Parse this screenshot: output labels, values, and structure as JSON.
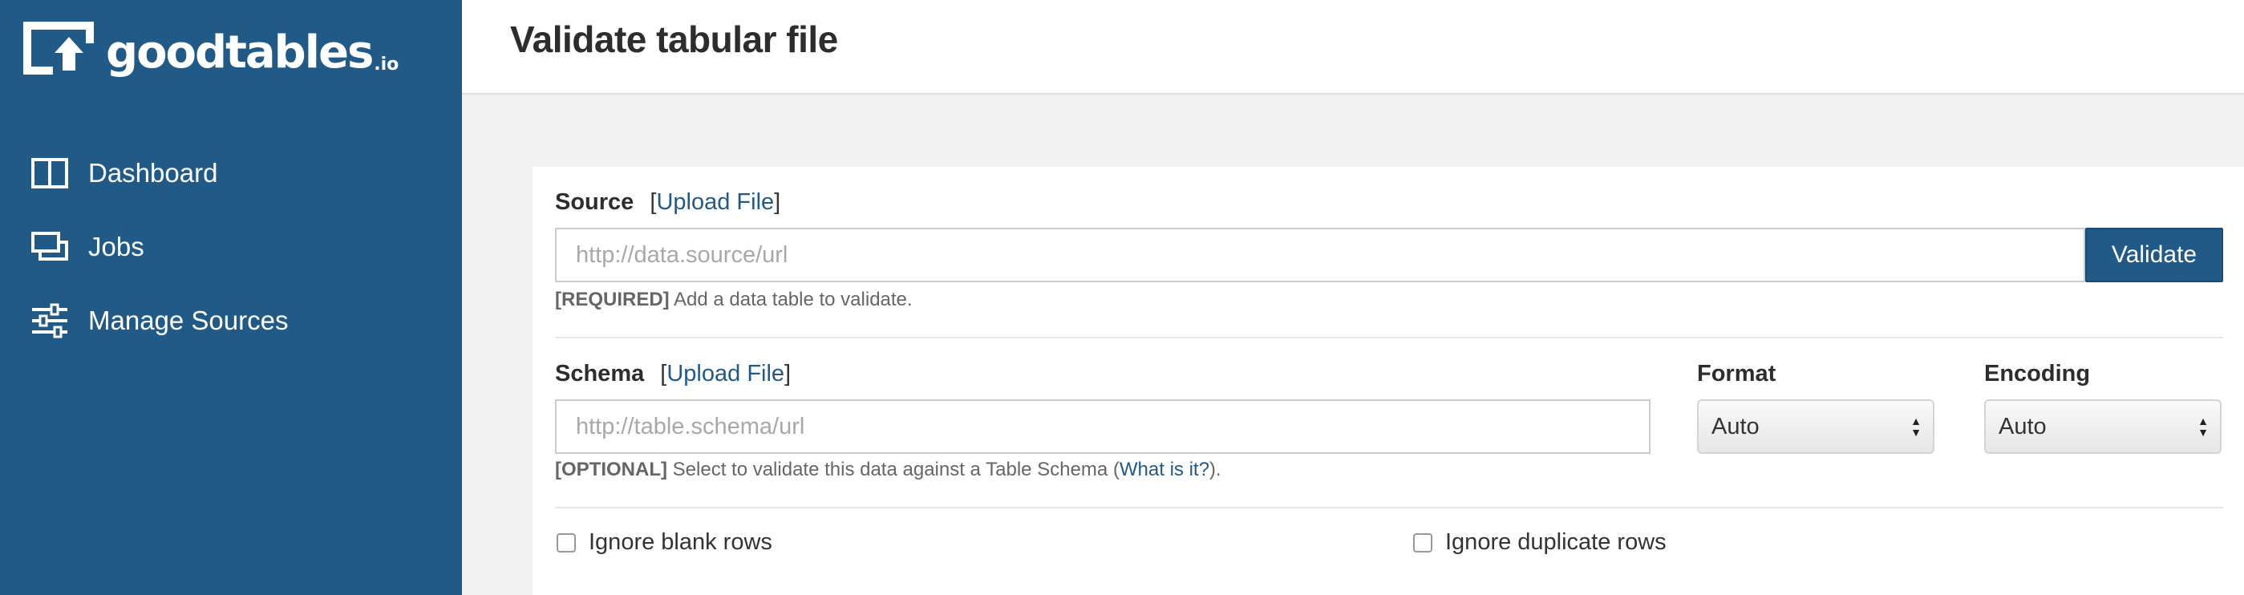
{
  "brand": {
    "name": "goodtables",
    "tld": ".io",
    "color": "#225a87"
  },
  "sidebar": {
    "items": [
      {
        "label": "Dashboard",
        "icon": "columns-icon"
      },
      {
        "label": "Jobs",
        "icon": "jobs-icon"
      },
      {
        "label": "Manage Sources",
        "icon": "sliders-icon"
      }
    ]
  },
  "header": {
    "title": "Validate tabular file"
  },
  "form": {
    "source": {
      "label": "Source",
      "upload_open": "[",
      "upload_label": "Upload File",
      "upload_close": "]",
      "placeholder": "http://data.source/url",
      "value": "",
      "help_tag": "[REQUIRED]",
      "help_text": " Add a data table to validate."
    },
    "validate_label": "Validate",
    "schema": {
      "label": "Schema",
      "upload_open": "[",
      "upload_label": "Upload File",
      "upload_close": "]",
      "placeholder": "http://table.schema/url",
      "value": "",
      "help_tag": "[OPTIONAL]",
      "help_text": " Select to validate this data against a Table Schema (",
      "help_link": "What is it?",
      "help_end": ")."
    },
    "format": {
      "label": "Format",
      "selected": "Auto"
    },
    "encoding": {
      "label": "Encoding",
      "selected": "Auto"
    },
    "ignore_blank_rows": {
      "label": "Ignore blank rows",
      "checked": false
    },
    "ignore_duplicate_rows": {
      "label": "Ignore duplicate rows",
      "checked": false
    }
  }
}
